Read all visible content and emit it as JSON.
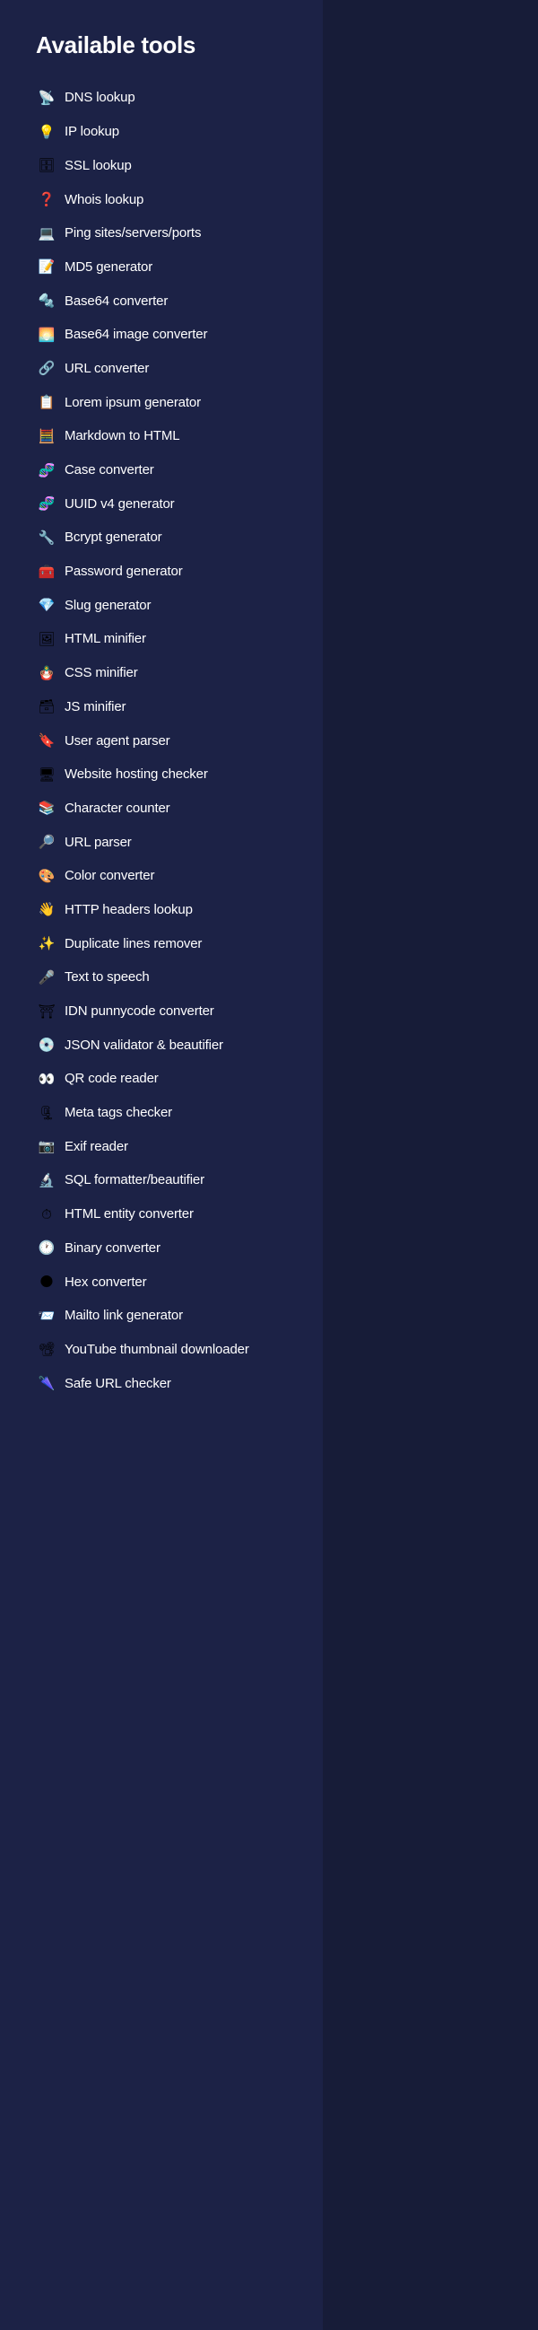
{
  "panel": {
    "title": "Available tools",
    "background_color": "#1c2246",
    "page_background_color": "#171c38",
    "text_color": "#ffffff"
  },
  "tools": [
    {
      "icon": "📡",
      "icon_name": "satellite-antenna-icon",
      "label": "DNS lookup"
    },
    {
      "icon": "💡",
      "icon_name": "light-bulb-icon",
      "label": "IP lookup"
    },
    {
      "icon": "🗄",
      "icon_name": "file-cabinet-icon",
      "label": "SSL lookup"
    },
    {
      "icon": "❓",
      "icon_name": "question-mark-icon",
      "label": "Whois lookup"
    },
    {
      "icon": "💻",
      "icon_name": "laptop-icon",
      "label": "Ping sites/servers/ports"
    },
    {
      "icon": "📝",
      "icon_name": "memo-icon",
      "label": "MD5 generator"
    },
    {
      "icon": "🔩",
      "icon_name": "nut-and-bolt-icon",
      "label": "Base64 converter"
    },
    {
      "icon": "🌅",
      "icon_name": "sunrise-icon",
      "label": "Base64 image converter"
    },
    {
      "icon": "🔗",
      "icon_name": "link-icon",
      "label": "URL converter"
    },
    {
      "icon": "📋",
      "icon_name": "clipboard-icon",
      "label": "Lorem ipsum generator"
    },
    {
      "icon": "🧮",
      "icon_name": "abacus-icon",
      "label": "Markdown to HTML"
    },
    {
      "icon": "🧬",
      "icon_name": "dna-icon",
      "label": "Case converter"
    },
    {
      "icon": "🧬",
      "icon_name": "dna-colored-icon",
      "label": "UUID v4 generator"
    },
    {
      "icon": "🔧",
      "icon_name": "wrench-icon",
      "label": "Bcrypt generator"
    },
    {
      "icon": "🧰",
      "icon_name": "toolbox-icon",
      "label": "Password generator"
    },
    {
      "icon": "💎",
      "icon_name": "gem-stone-icon",
      "label": "Slug generator"
    },
    {
      "icon": "🖼",
      "icon_name": "framed-picture-icon",
      "label": "HTML minifier"
    },
    {
      "icon": "🪆",
      "icon_name": "nesting-dolls-icon",
      "label": "CSS minifier"
    },
    {
      "icon": "🗃",
      "icon_name": "card-file-box-icon",
      "label": "JS minifier"
    },
    {
      "icon": "🔖",
      "icon_name": "bookmark-icon",
      "label": "User agent parser"
    },
    {
      "icon": "🖥",
      "icon_name": "desktop-computer-icon",
      "label": "Website hosting checker"
    },
    {
      "icon": "📚",
      "icon_name": "books-icon",
      "label": "Character counter"
    },
    {
      "icon": "🔎",
      "icon_name": "magnifying-glass-icon",
      "label": "URL parser"
    },
    {
      "icon": "🎨",
      "icon_name": "artist-palette-icon",
      "label": "Color converter"
    },
    {
      "icon": "👋",
      "icon_name": "waving-hand-icon",
      "label": "HTTP headers lookup"
    },
    {
      "icon": "✨",
      "icon_name": "sparkles-icon",
      "label": "Duplicate lines remover"
    },
    {
      "icon": "🎤",
      "icon_name": "microphone-icon",
      "label": "Text to speech"
    },
    {
      "icon": "⛩",
      "icon_name": "shinto-shrine-icon",
      "label": "IDN punnycode converter"
    },
    {
      "icon": "💿",
      "icon_name": "optical-disk-icon",
      "label": "JSON validator & beautifier"
    },
    {
      "icon": "👀",
      "icon_name": "eyes-icon",
      "label": "QR code reader"
    },
    {
      "icon": "🗜",
      "icon_name": "clamp-icon",
      "label": "Meta tags checker"
    },
    {
      "icon": "📷",
      "icon_name": "camera-icon",
      "label": "Exif reader"
    },
    {
      "icon": "🔬",
      "icon_name": "microscope-icon",
      "label": "SQL formatter/beautifier"
    },
    {
      "icon": "⏱",
      "icon_name": "stopwatch-icon",
      "label": "HTML entity converter"
    },
    {
      "icon": "🕐",
      "icon_name": "clock-icon",
      "label": "Binary converter"
    },
    {
      "icon": "🌑",
      "icon_name": "new-moon-icon",
      "label": "Hex converter"
    },
    {
      "icon": "📨",
      "icon_name": "incoming-envelope-icon",
      "label": "Mailto link generator"
    },
    {
      "icon": "📽",
      "icon_name": "film-projector-icon",
      "label": "YouTube thumbnail downloader"
    },
    {
      "icon": "🌂",
      "icon_name": "closed-umbrella-icon",
      "label": "Safe URL checker"
    }
  ]
}
